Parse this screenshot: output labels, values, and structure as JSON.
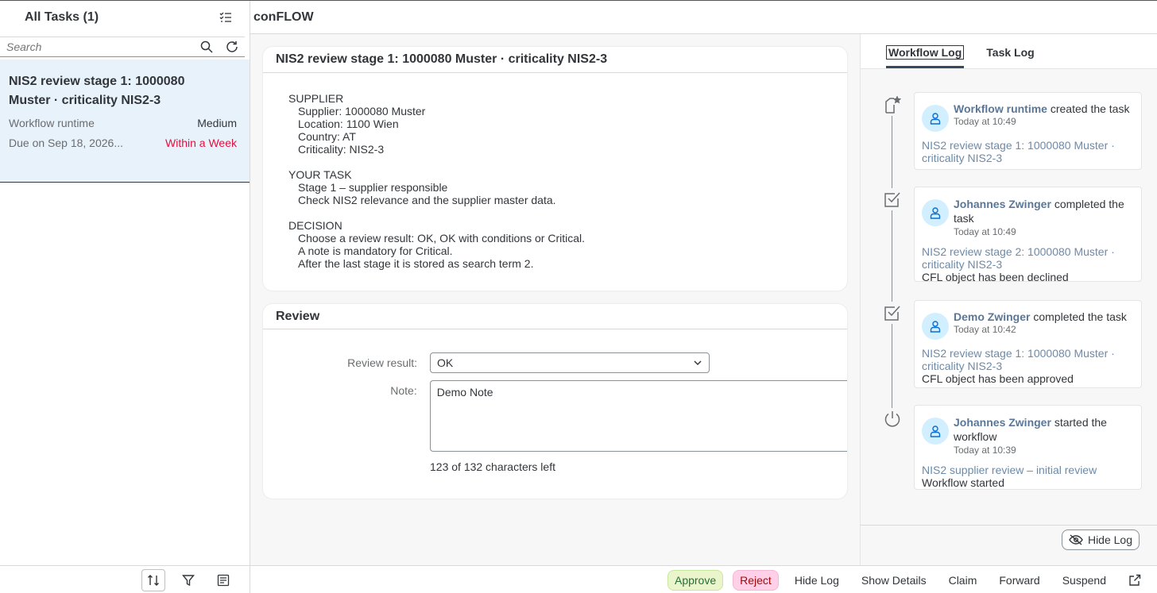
{
  "master": {
    "title": "All Tasks (1)",
    "search_placeholder": "Search",
    "task": {
      "title_line1": "NIS2 review stage 1: 1000080",
      "title_line2": "Muster · criticality NIS2-3",
      "creator": "Workflow runtime",
      "priority": "Medium",
      "due": "Due on Sep 18, 2026...",
      "due_status": "Within a Week"
    }
  },
  "header": {
    "app_title": "conFLOW"
  },
  "description": {
    "title": "NIS2 review stage 1: 1000080 Muster · criticality NIS2-3",
    "sections": [
      {
        "heading": "SUPPLIER",
        "lines": [
          "Supplier: 1000080 Muster",
          "Location: 1100 Wien",
          "Country: AT",
          "Criticality: NIS2-3"
        ]
      },
      {
        "heading": "YOUR TASK",
        "lines": [
          "Stage 1 – supplier responsible",
          "Check NIS2 relevance and the supplier master data."
        ]
      },
      {
        "heading": "DECISION",
        "lines": [
          "Choose a review result: OK, OK with conditions or Critical.",
          "A note is mandatory for Critical.",
          "After the last stage it is stored as search term 2."
        ]
      }
    ]
  },
  "review": {
    "title": "Review",
    "result_label": "Review result:",
    "result_value": "OK",
    "note_label": "Note:",
    "note_value": "Demo Note",
    "counter": "123 of 132 characters left"
  },
  "log": {
    "tabs": [
      "Workflow Log",
      "Task Log"
    ],
    "entries": [
      {
        "who": "Workflow runtime",
        "action": "created the task",
        "when": "Today at 10:49",
        "ref": "NIS2 review stage 1: 1000080 Muster · criticality NIS2-3",
        "msg": ""
      },
      {
        "who": "Johannes Zwinger",
        "action": "completed the task",
        "when": "Today at 10:49",
        "ref": "NIS2 review stage 2: 1000080 Muster · criticality NIS2-3",
        "msg": "CFL object has been declined"
      },
      {
        "who": "Demo Zwinger",
        "action": "completed the task",
        "when": "Today at 10:42",
        "ref": "NIS2 review stage 1: 1000080 Muster · criticality NIS2-3",
        "msg": "CFL object has been approved"
      },
      {
        "who": "Johannes Zwinger",
        "action": "started the workflow",
        "when": "Today at 10:39",
        "ref": "NIS2 supplier review – initial review",
        "msg": "Workflow started"
      }
    ],
    "hide_log": "Hide Log"
  },
  "actions": {
    "approve": "Approve",
    "reject": "Reject",
    "hide_log": "Hide Log",
    "show_details": "Show Details",
    "claim": "Claim",
    "forward": "Forward",
    "suspend": "Suspend"
  }
}
